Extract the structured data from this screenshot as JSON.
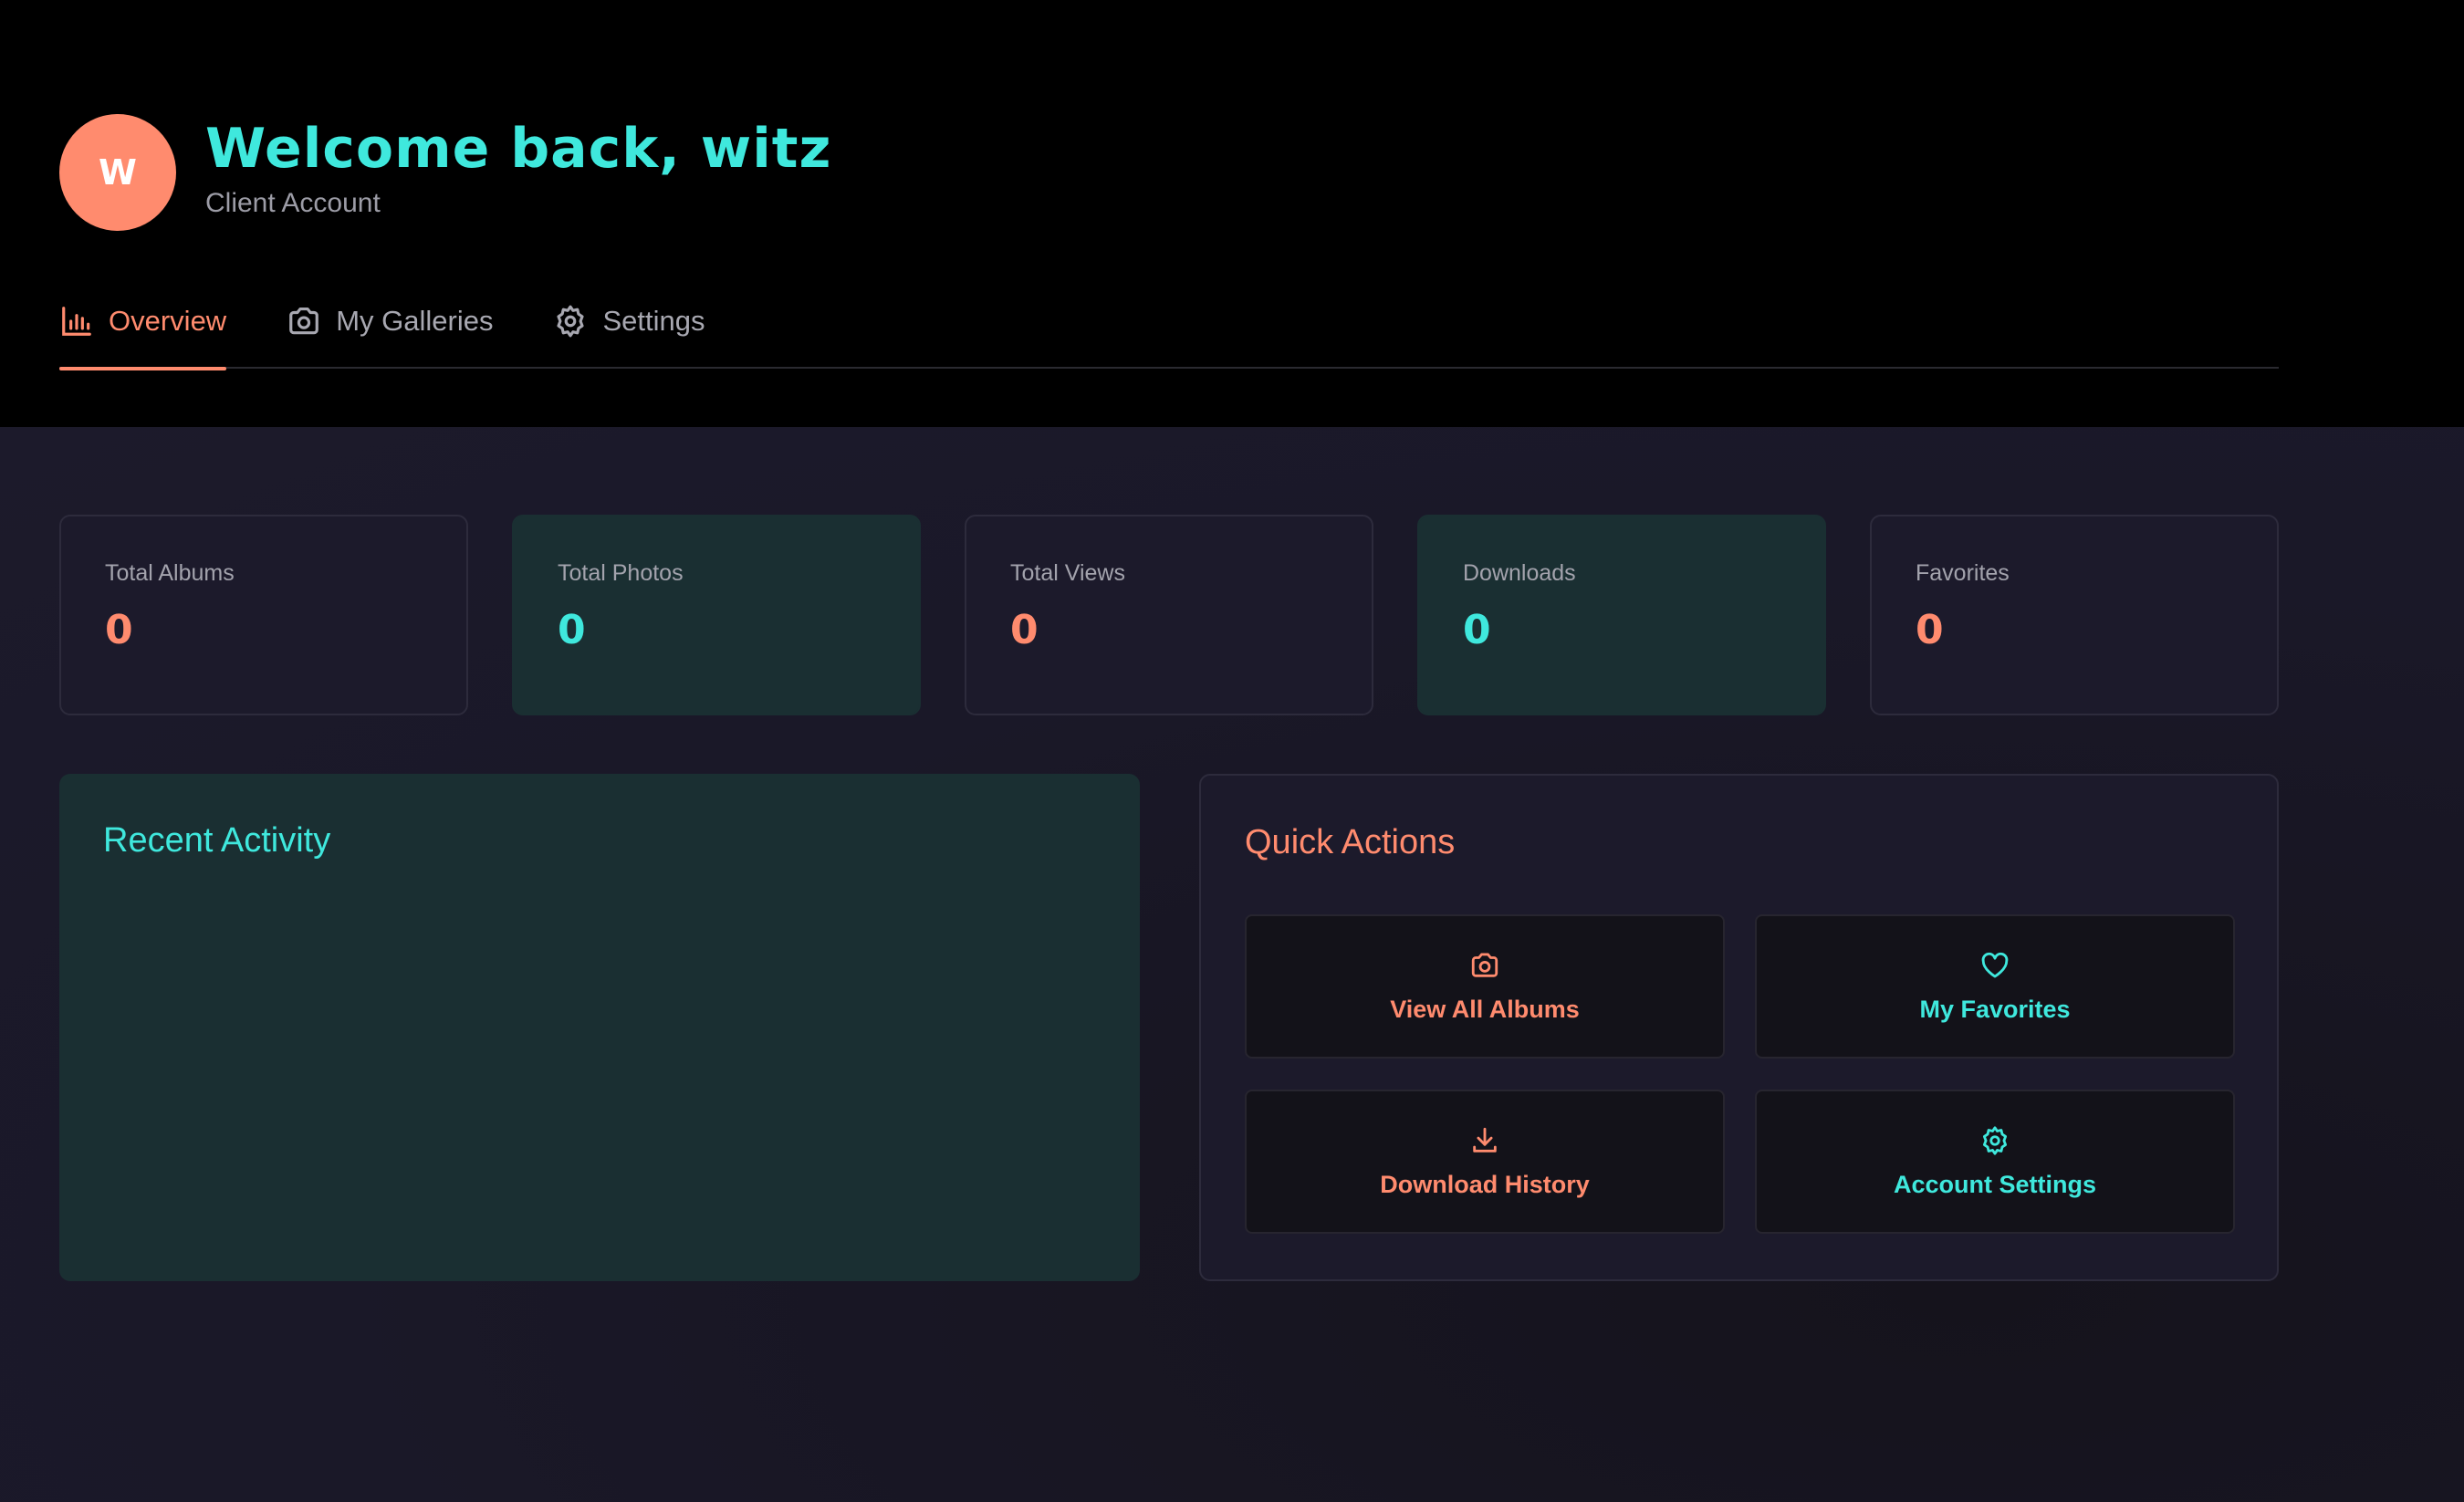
{
  "colors": {
    "accent_orange": "#ff8b6e",
    "accent_cyan": "#3fe8dd",
    "header_bg": "#000000",
    "main_bg": "#1c1a2b",
    "teal_card_bg": "#1a2f32"
  },
  "header": {
    "avatar_initial": "W",
    "welcome": "Welcome back, witz",
    "account_type": "Client Account"
  },
  "tabs": [
    {
      "label": "Overview",
      "icon": "bar-chart-icon",
      "active": true
    },
    {
      "label": "My Galleries",
      "icon": "camera-icon",
      "active": false
    },
    {
      "label": "Settings",
      "icon": "gear-icon",
      "active": false
    }
  ],
  "stats": [
    {
      "label": "Total Albums",
      "value": "0"
    },
    {
      "label": "Total Photos",
      "value": "0"
    },
    {
      "label": "Total Views",
      "value": "0"
    },
    {
      "label": "Downloads",
      "value": "0"
    },
    {
      "label": "Favorites",
      "value": "0"
    }
  ],
  "recent_activity": {
    "title": "Recent Activity"
  },
  "quick_actions": {
    "title": "Quick Actions",
    "items": [
      {
        "label": "View All Albums",
        "icon": "camera-icon"
      },
      {
        "label": "My Favorites",
        "icon": "heart-icon"
      },
      {
        "label": "Download History",
        "icon": "download-icon"
      },
      {
        "label": "Account Settings",
        "icon": "gear-icon"
      }
    ]
  }
}
